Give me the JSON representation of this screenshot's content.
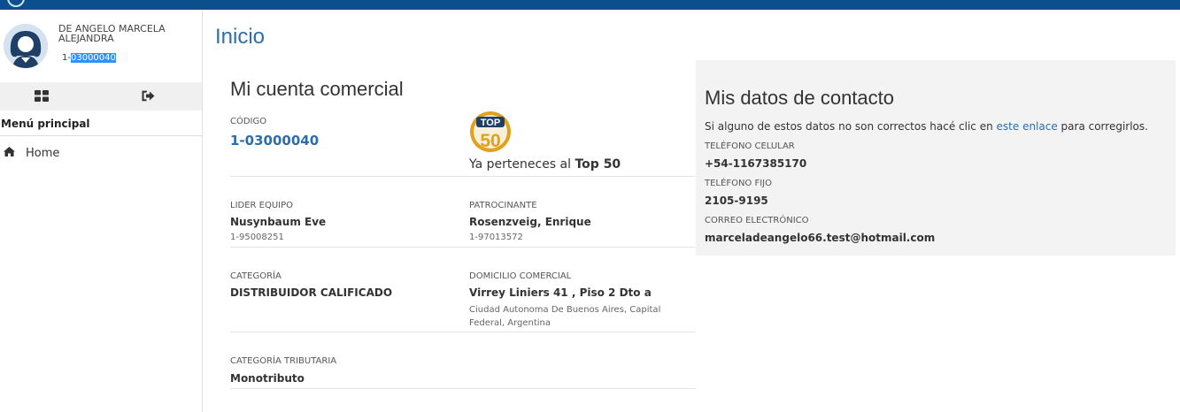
{
  "user": {
    "name": "DE ANGELO MARCELA ALEJANDRA",
    "code_prefix": "1-",
    "code_selected": "03000040"
  },
  "sidebar": {
    "menu_title": "Menú principal",
    "items": [
      {
        "label": "Home",
        "icon": "home-icon"
      }
    ],
    "action_icons": [
      "dashboard-icon",
      "logout-icon"
    ]
  },
  "page": {
    "title": "Inicio"
  },
  "account": {
    "title": "Mi cuenta comercial",
    "code_label": "CÓDIGO",
    "code_value": "1-03000040",
    "top50_badge_top": "TOP",
    "top50_badge_num": "50",
    "top50_prefix": "Ya perteneces al ",
    "top50_bold": "Top 50",
    "leader_label": "LIDER EQUIPO",
    "leader_name": "Nusynbaum Eve",
    "leader_code": "1-95008251",
    "sponsor_label": "PATROCINANTE",
    "sponsor_name": "Rosenzveig, Enrique",
    "sponsor_code": "1-97013572",
    "category_label": "CATEGORÍA",
    "category_value": "DISTRIBUIDOR CALIFICADO",
    "address_label": "DOMICILIO COMERCIAL",
    "address_line1": "Virrey Liniers 41 , Piso 2 Dto a",
    "address_line2": "Ciudad Autonoma De Buenos Aires, Capital",
    "address_line3": "Federal, Argentina",
    "tax_label": "CATEGORÍA TRIBUTARIA",
    "tax_value": "Monotributo"
  },
  "contact": {
    "title": "Mis datos de contacto",
    "desc_before": "Si alguno de estos datos no son correctos hacé clic en ",
    "desc_link": "este enlace",
    "desc_after": " para corregirlos.",
    "mobile_label": "TELÉFONO CELULAR",
    "mobile_value": "+54-1167385170",
    "phone_label": "TELÉFONO FIJO",
    "phone_value": "2105-9195",
    "email_label": "CORREO ELECTRÓNICO",
    "email_value": "marceladeangelo66.test@hotmail.com"
  },
  "colors": {
    "header": "#0b4f8f",
    "accent": "#2d6ea8",
    "gold": "#e0a21c"
  }
}
